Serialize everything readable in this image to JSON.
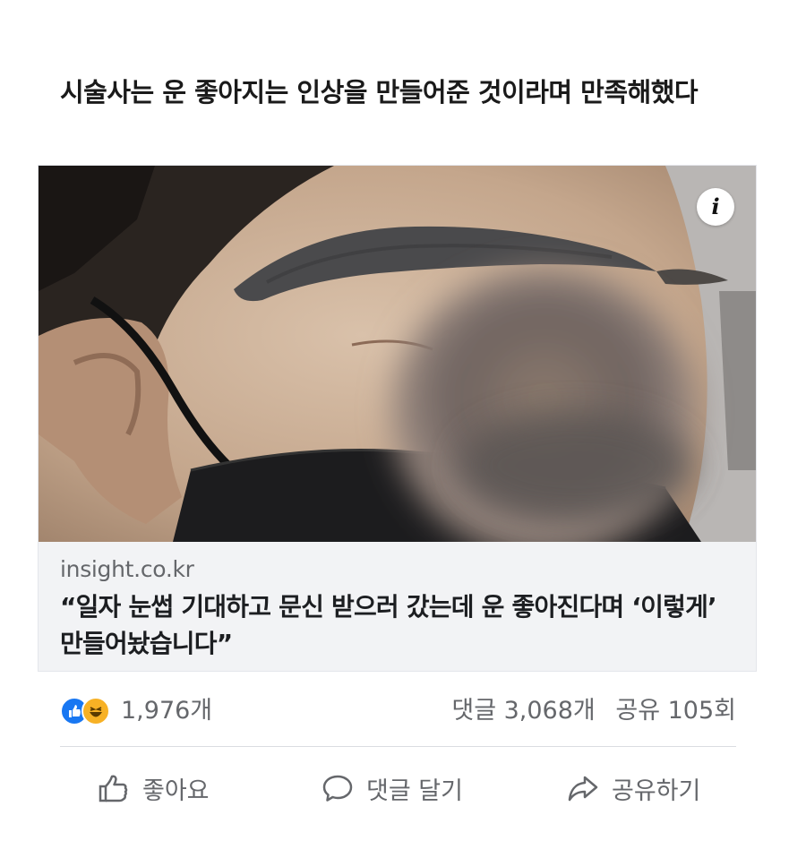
{
  "post": {
    "text": "시술사는 운 좋아지는 인상을 만들어준 것이라며 만족해했다"
  },
  "link_card": {
    "info_badge": "i",
    "domain": "insight.co.kr",
    "title": "“일자 눈썹 기대하고 문신 받으러 갔는데 운 좋아진다며 ‘이렇게’ 만들어놨습니다”"
  },
  "stats": {
    "reaction_icons": [
      "like-icon",
      "haha-icon"
    ],
    "reactions": "1,976개",
    "comments": "댓글 3,068개",
    "shares": "공유 105회"
  },
  "actions": {
    "like": "좋아요",
    "comment": "댓글 달기",
    "share": "공유하기"
  },
  "colors": {
    "like_blue": "#1877f2",
    "haha_yellow": "#f7b125",
    "meta_gray": "#65676b",
    "card_bg": "#f2f3f5"
  }
}
